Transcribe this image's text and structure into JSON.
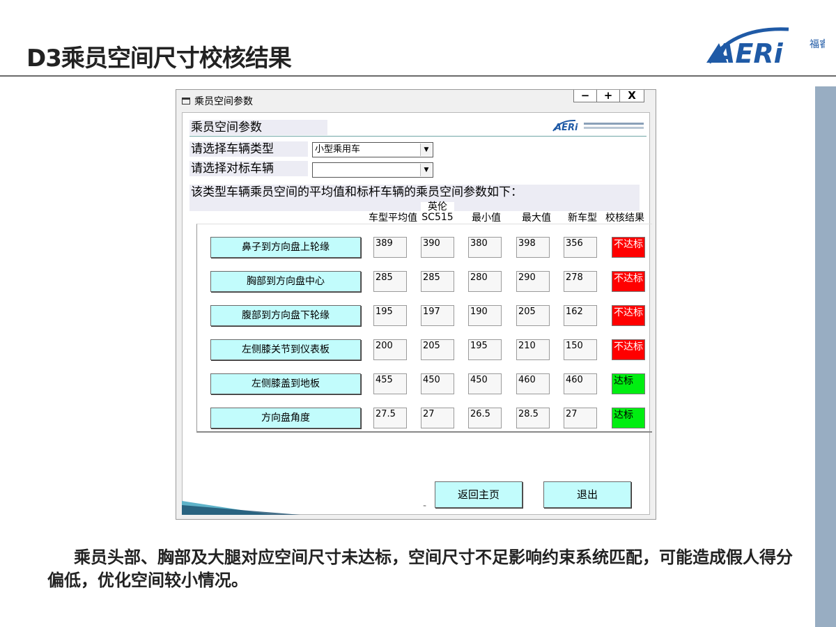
{
  "slide": {
    "title": "D3乘员空间尺寸校核结果",
    "logo_text": "AERi",
    "logo_side_text": "福睿",
    "caption": "乘员头部、胸部及大腿对应空间尺寸未达标，空间尺寸不足影响约束系统匹配，可能造成假人得分偏低，优化空间较小情况。"
  },
  "window": {
    "title": "乘员空间参数",
    "icon": "window-icon",
    "controls": {
      "minimize": "−",
      "maximize": "+",
      "close": "X"
    },
    "header_label": "乘员空间参数",
    "mini_logo_text": "AERi",
    "vehicle_type_label": "请选择车辆类型",
    "vehicle_type_value": "小型乘用车",
    "benchmark_label": "请选择对标车辆",
    "benchmark_value": "",
    "description": "该类型车辆乘员空间的平均值和标杆车辆的乘员空间参数如下：",
    "tiny_mark": "≈"
  },
  "table": {
    "columns": {
      "avg": "车型平均值",
      "bench_line1": "英伦",
      "bench_line2": "SC515",
      "min": "最小值",
      "max": "最大值",
      "new": "新车型",
      "result": "校核结果"
    },
    "rows": [
      {
        "label": "鼻子到方向盘上轮缘",
        "avg": "389",
        "bench": "390",
        "min": "380",
        "max": "398",
        "new": "356",
        "result": "不达标",
        "status": "fail"
      },
      {
        "label": "胸部到方向盘中心",
        "avg": "285",
        "bench": "285",
        "min": "280",
        "max": "290",
        "new": "278",
        "result": "不达标",
        "status": "fail"
      },
      {
        "label": "腹部到方向盘下轮缘",
        "avg": "195",
        "bench": "197",
        "min": "190",
        "max": "205",
        "new": "162",
        "result": "不达标",
        "status": "fail"
      },
      {
        "label": "左侧膝关节到仪表板",
        "avg": "200",
        "bench": "205",
        "min": "195",
        "max": "210",
        "new": "150",
        "result": "不达标",
        "status": "fail"
      },
      {
        "label": "左侧膝盖到地板",
        "avg": "455",
        "bench": "450",
        "min": "450",
        "max": "460",
        "new": "460",
        "result": "达标",
        "status": "pass"
      },
      {
        "label": "方向盘角度",
        "avg": "27.5",
        "bench": "27",
        "min": "26.5",
        "max": "28.5",
        "new": "27",
        "result": "达标",
        "status": "pass"
      }
    ]
  },
  "actions": {
    "home": "返回主页",
    "exit": "退出"
  },
  "colors": {
    "fail": "#ff0000",
    "pass": "#00ee11",
    "button": "#c2fcfc",
    "logo_blue": "#1f5aa6",
    "side_bar": "#98adc2"
  }
}
